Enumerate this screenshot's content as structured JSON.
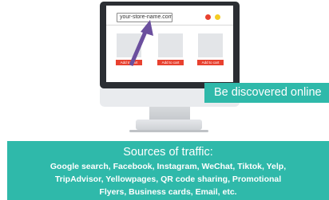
{
  "browser": {
    "url": "your-store-name.com",
    "dot_colors": [
      "#e8412f",
      "#f4cc23"
    ]
  },
  "products": [
    {
      "button_label": "Add to cart"
    },
    {
      "button_label": "Add to cart"
    },
    {
      "button_label": "Add to cart"
    }
  ],
  "banner": {
    "text": "Be discovered online",
    "color": "#2fb9aa"
  },
  "traffic": {
    "title": "Sources of traffic:",
    "lines": [
      "Google search, Facebook, Instagram, WeChat, Tiktok, Yelp,",
      "TripAdvisor, Yellowpages, QR code sharing, Promotional",
      "Flyers, Business cards, Email, etc."
    ]
  },
  "accent_colors": {
    "arrow": "#6b4f9e",
    "monitor": "#2b2e33",
    "cart_button": "#e8412f"
  }
}
